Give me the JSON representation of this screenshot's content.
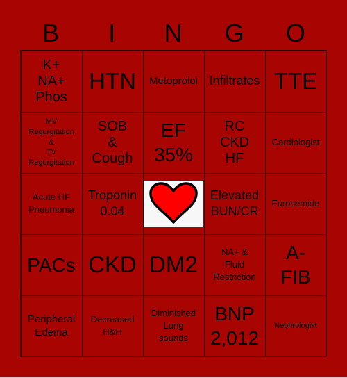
{
  "header": {
    "letters": [
      "B",
      "I",
      "N",
      "G",
      "O"
    ]
  },
  "colors": {
    "background": "#a80402",
    "border": "#2a0000",
    "free_space_bg": "#f7f7f7",
    "heart_fill": "#ff0000",
    "heart_stroke": "#000000"
  },
  "cells": [
    [
      {
        "text": "K+\nNA+\nPhos"
      },
      {
        "text": "HTN"
      },
      {
        "text": "Metoprolol"
      },
      {
        "text": "Infiltrates"
      },
      {
        "text": "TTE"
      }
    ],
    [
      {
        "text": "MV\nRegurgitation\n&\nTV\nRegurgitation"
      },
      {
        "text": "SOB\n&\nCough"
      },
      {
        "text": "EF\n35%"
      },
      {
        "text": "RC\nCKD\nHF"
      },
      {
        "text": "Cardiologist"
      }
    ],
    [
      {
        "text": "Acute HF\nPneumonia"
      },
      {
        "text": "Troponin\n0.04"
      },
      {
        "text": "",
        "free_space": true,
        "icon": "heart-icon"
      },
      {
        "text": "Elevated\nBUN/CR"
      },
      {
        "text": "Furosemide"
      }
    ],
    [
      {
        "text": "PACs"
      },
      {
        "text": "CKD"
      },
      {
        "text": "DM2"
      },
      {
        "text": "NA+ &\nFluid\nRestriction"
      },
      {
        "text": "A-\nFIB"
      }
    ],
    [
      {
        "text": "Peripheral\nEdema"
      },
      {
        "text": "Decreased\nH&H"
      },
      {
        "text": "Diminished\nLung\nsounds"
      },
      {
        "text": "BNP\n2,012"
      },
      {
        "text": "Nephrologist"
      }
    ]
  ]
}
